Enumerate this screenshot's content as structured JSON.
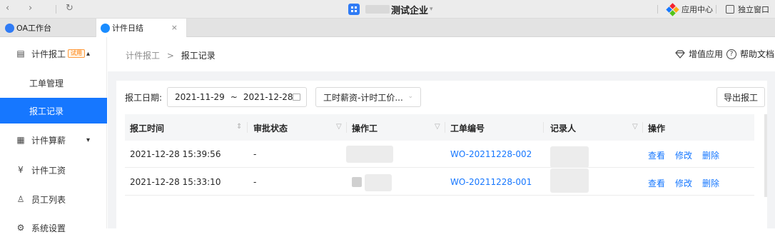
{
  "browser": {
    "back": "‹",
    "forward": "›",
    "reload": "↻",
    "company_name": "测试企业",
    "company_caret": "▾",
    "app_center": "应用中心",
    "standalone_window": "独立窗口"
  },
  "tabs": [
    {
      "label": "OA工作台"
    },
    {
      "label": "计件日结",
      "close": "×"
    }
  ],
  "sidebar": {
    "sections": [
      {
        "label": "计件报工",
        "badge": "试用",
        "chevron": "▴",
        "icon": "report-icon"
      },
      {
        "label": "计件算薪",
        "chevron": "▾",
        "icon": "calculator-icon"
      },
      {
        "label": "计件工资",
        "icon": "yen-icon"
      },
      {
        "label": "员工列表",
        "icon": "user-icon"
      },
      {
        "label": "系统设置",
        "icon": "gear-icon"
      }
    ],
    "sub_items": [
      {
        "label": "工单管理",
        "active": false
      },
      {
        "label": "报工记录",
        "active": true
      }
    ]
  },
  "header": {
    "breadcrumb_parent": "计件报工",
    "breadcrumb_sep": ">",
    "breadcrumb_current": "报工记录",
    "value_added": "增值应用",
    "help_docs": "帮助文档"
  },
  "filters": {
    "date_label": "报工日期:",
    "date_start": "2021-11-29",
    "date_sep": "~",
    "date_end": "2021-12-28",
    "wage_type": "工时薪资-计时工价...",
    "export_label": "导出报工"
  },
  "table": {
    "columns": [
      "报工时间",
      "审批状态",
      "操作工",
      "工单编号",
      "记录人",
      "操作"
    ],
    "rows": [
      {
        "time": "2021-12-28 15:39:56",
        "status": "-",
        "order_no": "WO-20211228-002",
        "actions": [
          "查看",
          "修改",
          "删除"
        ]
      },
      {
        "time": "2021-12-28 15:33:10",
        "status": "-",
        "order_no": "WO-20211228-001",
        "actions": [
          "查看",
          "修改",
          "删除"
        ]
      }
    ]
  },
  "colors": {
    "accent": "#1677ff",
    "badge": "#ff7a00"
  }
}
